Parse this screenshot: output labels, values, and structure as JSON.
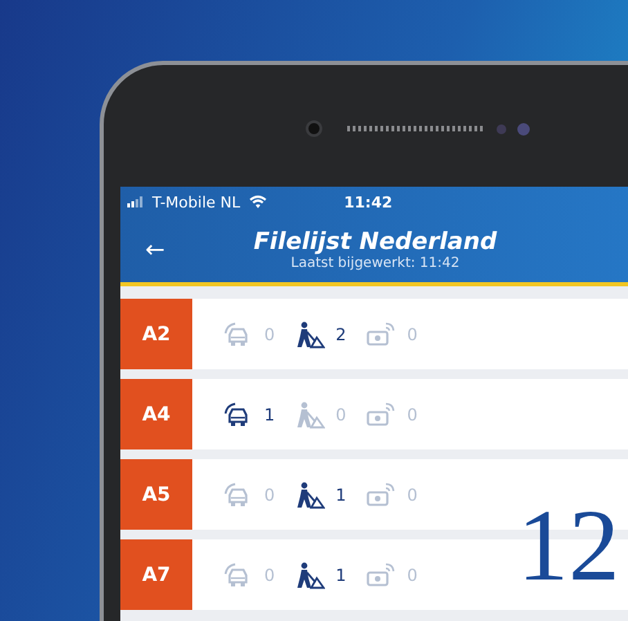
{
  "status_bar": {
    "carrier": "T-Mobile NL",
    "time": "11:42"
  },
  "header": {
    "back": "←",
    "title": "Filelijst Nederland",
    "subtitle": "Laatst bijgewerkt: 11:42"
  },
  "roads": [
    {
      "name": "A2",
      "counters": [
        {
          "kind": "jam",
          "count": "0",
          "active": false
        },
        {
          "kind": "roadworks",
          "count": "2",
          "active": true
        },
        {
          "kind": "camera",
          "count": "0",
          "active": false
        }
      ]
    },
    {
      "name": "A4",
      "counters": [
        {
          "kind": "jam",
          "count": "1",
          "active": true
        },
        {
          "kind": "roadworks",
          "count": "0",
          "active": false
        },
        {
          "kind": "camera",
          "count": "0",
          "active": false
        }
      ]
    },
    {
      "name": "A5",
      "counters": [
        {
          "kind": "jam",
          "count": "0",
          "active": false
        },
        {
          "kind": "roadworks",
          "count": "1",
          "active": true
        },
        {
          "kind": "camera",
          "count": "0",
          "active": false
        }
      ]
    },
    {
      "name": "A7",
      "counters": [
        {
          "kind": "jam",
          "count": "0",
          "active": false
        },
        {
          "kind": "roadworks",
          "count": "1",
          "active": true
        },
        {
          "kind": "camera",
          "count": "0",
          "active": false
        }
      ]
    }
  ],
  "page_number": "12"
}
